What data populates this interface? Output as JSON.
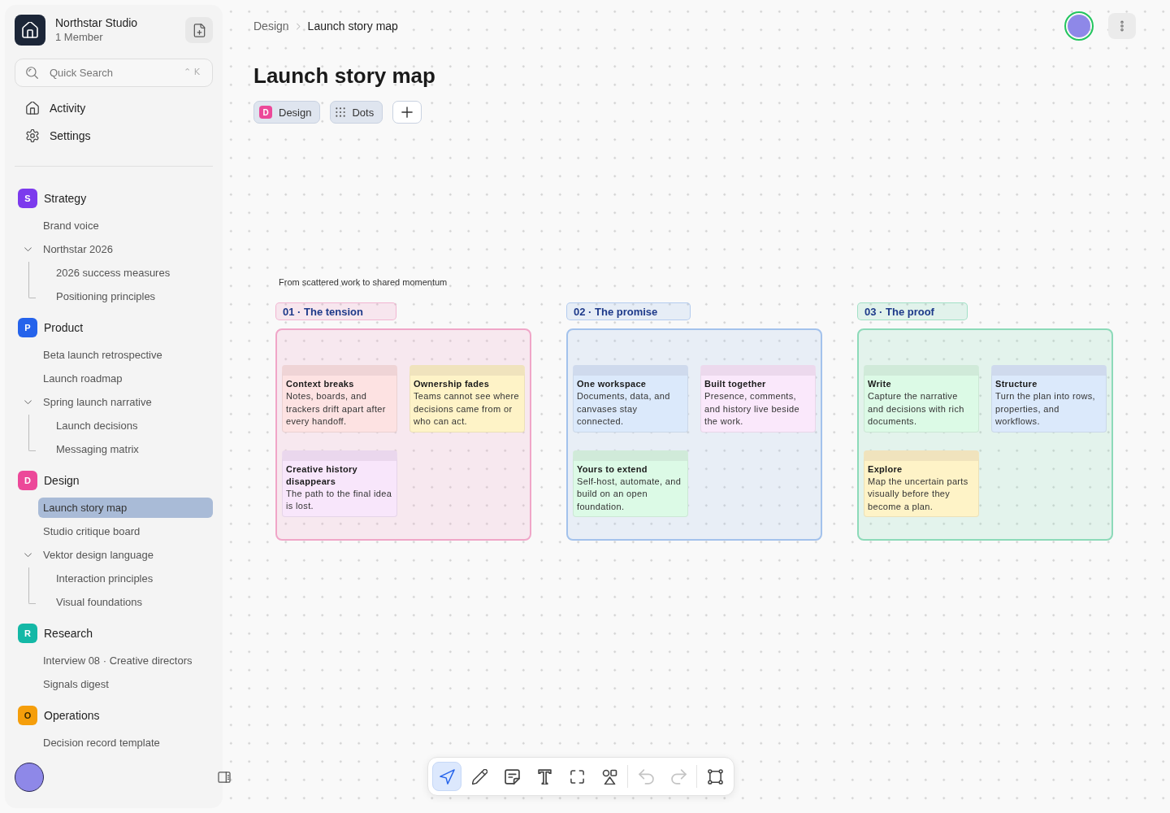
{
  "sidebar": {
    "workspace": {
      "name": "Northstar Studio",
      "members": "1 Member"
    },
    "search": {
      "placeholder": "Quick Search",
      "shortcut": "⌃ K"
    },
    "nav": [
      {
        "kind": "activity",
        "label": "Activity"
      },
      {
        "kind": "settings",
        "label": "Settings"
      }
    ],
    "sections": [
      {
        "badge": "S",
        "label": "Strategy",
        "color": "#7c3aed",
        "items": [
          {
            "label": "Brand voice",
            "selected": false
          },
          {
            "label": "Northstar 2026",
            "selected": false,
            "expanded": true,
            "children": [
              {
                "label": "2026 success measures",
                "selected": false
              },
              {
                "label": "Positioning principles",
                "selected": false
              }
            ]
          }
        ]
      },
      {
        "badge": "P",
        "label": "Product",
        "color": "#2563eb",
        "items": [
          {
            "label": "Beta launch retrospective",
            "selected": false
          },
          {
            "label": "Launch roadmap",
            "selected": false
          },
          {
            "label": "Spring launch narrative",
            "selected": false,
            "expanded": true,
            "children": [
              {
                "label": "Launch decisions",
                "selected": false
              },
              {
                "label": "Messaging matrix",
                "selected": false
              }
            ]
          }
        ]
      },
      {
        "badge": "D",
        "label": "Design",
        "color": "#ec4899",
        "items": [
          {
            "label": "Launch story map",
            "selected": true
          },
          {
            "label": "Studio critique board",
            "selected": false
          },
          {
            "label": "Vektor design language",
            "selected": false,
            "expanded": true,
            "children": [
              {
                "label": "Interaction principles",
                "selected": false
              },
              {
                "label": "Visual foundations",
                "selected": false
              }
            ]
          }
        ]
      },
      {
        "badge": "R",
        "label": "Research",
        "color": "#14b8a6",
        "items": [
          {
            "label": "Interview 08 · Creative directors",
            "selected": false
          },
          {
            "label": "Signals digest",
            "selected": false
          }
        ]
      },
      {
        "badge": "O",
        "label": "Operations",
        "color": "#f59e0b",
        "items": [
          {
            "label": "Decision record template",
            "selected": false
          }
        ]
      }
    ]
  },
  "header": {
    "breadcrumb": [
      "Design",
      "Launch story map"
    ],
    "title": "Launch story map",
    "tags": [
      {
        "kind": "space",
        "badge": "D",
        "label": "Design",
        "color": "#ec4899"
      },
      {
        "kind": "view",
        "label": "Dots"
      }
    ],
    "user": {
      "online": true
    }
  },
  "canvas": {
    "caption": "From scattered work to shared momentum",
    "groups": [
      {
        "label": "01 · The tension",
        "color": "#f0a6c8",
        "cards": [
          {
            "title": "Context breaks",
            "body": "Notes, boards, and trackers drift apart after every handoff.",
            "color": "#fde2e2"
          },
          {
            "title": "Ownership fades",
            "body": "Teams cannot see where decisions came from or who can act.",
            "color": "#fef3c7"
          },
          {
            "title": "Creative history disappears",
            "body": "The path to the final idea is lost.",
            "color": "#f8e6fb"
          }
        ]
      },
      {
        "label": "02 · The promise",
        "color": "#a3c2ec",
        "cards": [
          {
            "title": "One workspace",
            "body": "Documents, data, and canvases stay connected.",
            "color": "#dbe9fb"
          },
          {
            "title": "Built together",
            "body": "Presence, comments, and history live beside the work.",
            "color": "#fae8fb"
          },
          {
            "title": "Yours to extend",
            "body": "Self-host, automate, and build on an open foundation.",
            "color": "#dcfae6"
          }
        ]
      },
      {
        "label": "03 · The proof",
        "color": "#8ddab9",
        "cards": [
          {
            "title": "Write",
            "body": "Capture the narrative and decisions with rich documents.",
            "color": "#dcfae6"
          },
          {
            "title": "Structure",
            "body": "Turn the plan into rows, properties, and workflows.",
            "color": "#dbe9fb"
          },
          {
            "title": "Explore",
            "body": "Map the uncertain parts visually before they become a plan.",
            "color": "#fef3c7"
          }
        ]
      }
    ]
  },
  "toolbar": {
    "groups": [
      {
        "tools": [
          {
            "kind": "select",
            "selected": true
          },
          {
            "kind": "pencil",
            "selected": false
          },
          {
            "kind": "note",
            "selected": false
          },
          {
            "kind": "text",
            "selected": false
          },
          {
            "kind": "frame",
            "selected": false
          },
          {
            "kind": "shapes",
            "selected": false
          }
        ]
      },
      {
        "tools": [
          {
            "kind": "undo",
            "disabled": true
          },
          {
            "kind": "redo",
            "disabled": true
          }
        ]
      },
      {
        "tools": [
          {
            "kind": "fit"
          }
        ]
      }
    ]
  }
}
